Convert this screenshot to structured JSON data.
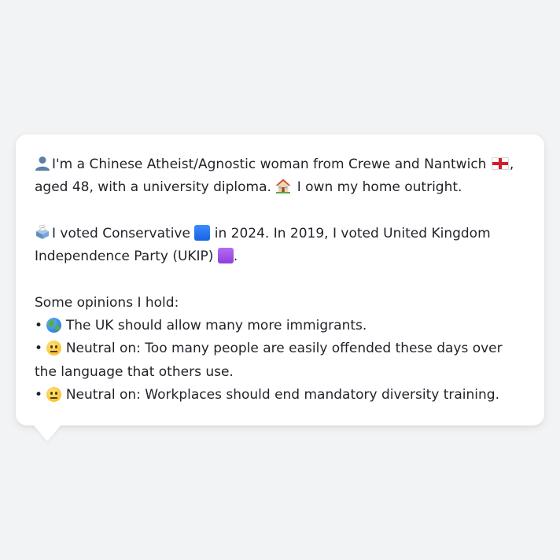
{
  "profile": {
    "line1": {
      "text_a": "I'm a Chinese Atheist/Agnostic woman from Crewe and Nantwich",
      "text_b": ",",
      "text_c": "aged 48, with a university diploma.",
      "text_d": "I own my home outright."
    },
    "line2": {
      "text_a": "I voted Conservative",
      "text_b": "in 2024. In 2019, I voted United Kingdom Independence Party (UKIP)",
      "text_c": "."
    },
    "opinions_heading": "Some opinions I hold:",
    "opinions": [
      {
        "bullet": "•",
        "icon": "globe-icon",
        "text": "The UK should allow many more immigrants."
      },
      {
        "bullet": "•",
        "icon": "neutral-face-icon",
        "text": "Neutral on: Too many people are easily offended these days over the language that others use."
      },
      {
        "bullet": "•",
        "icon": "neutral-face-icon",
        "text": "Neutral on: Workplaces should end mandatory diversity training."
      }
    ]
  },
  "colors": {
    "background": "#f2f3f5",
    "bubble": "#ffffff",
    "text": "#1f2328",
    "conservative": "#1663e4",
    "ukip": "#8f3fdc",
    "flag_red": "#d31e2a"
  }
}
